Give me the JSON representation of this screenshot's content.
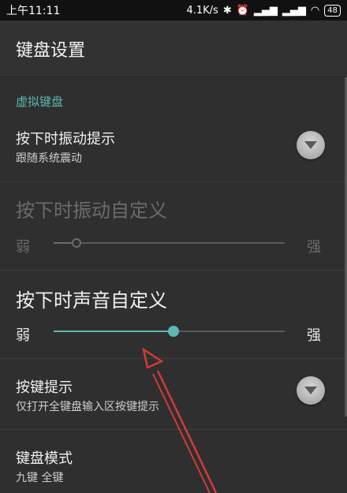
{
  "statusbar": {
    "time": "上午11:11",
    "net_speed": "4.1K/s",
    "battery": "48"
  },
  "appbar": {
    "title": "键盘设置"
  },
  "section": {
    "title": "虚拟键盘"
  },
  "items": {
    "vibration_hint": {
      "title": "按下时振动提示",
      "summary": "跟随系统震动",
      "enabled": false
    },
    "vibration_custom": {
      "title": "按下时振动自定义",
      "min_label": "弱",
      "max_label": "强",
      "level": 0.1,
      "disabled": true
    },
    "sound_custom": {
      "title": "按下时声音自定义",
      "min_label": "弱",
      "max_label": "强",
      "level": 0.52,
      "disabled": false
    },
    "key_hint": {
      "title": "按键提示",
      "summary": "仅打开全键盘输入区按键提示",
      "enabled": false
    },
    "keyboard_mode": {
      "title": "键盘模式",
      "summary": "九键 全键"
    }
  },
  "colors": {
    "accent": "#5bb9b1",
    "disabled_text": "#6b6b6b",
    "track_inactive": "#5a5a5a",
    "annotation_arrow": "#d23a3a"
  }
}
